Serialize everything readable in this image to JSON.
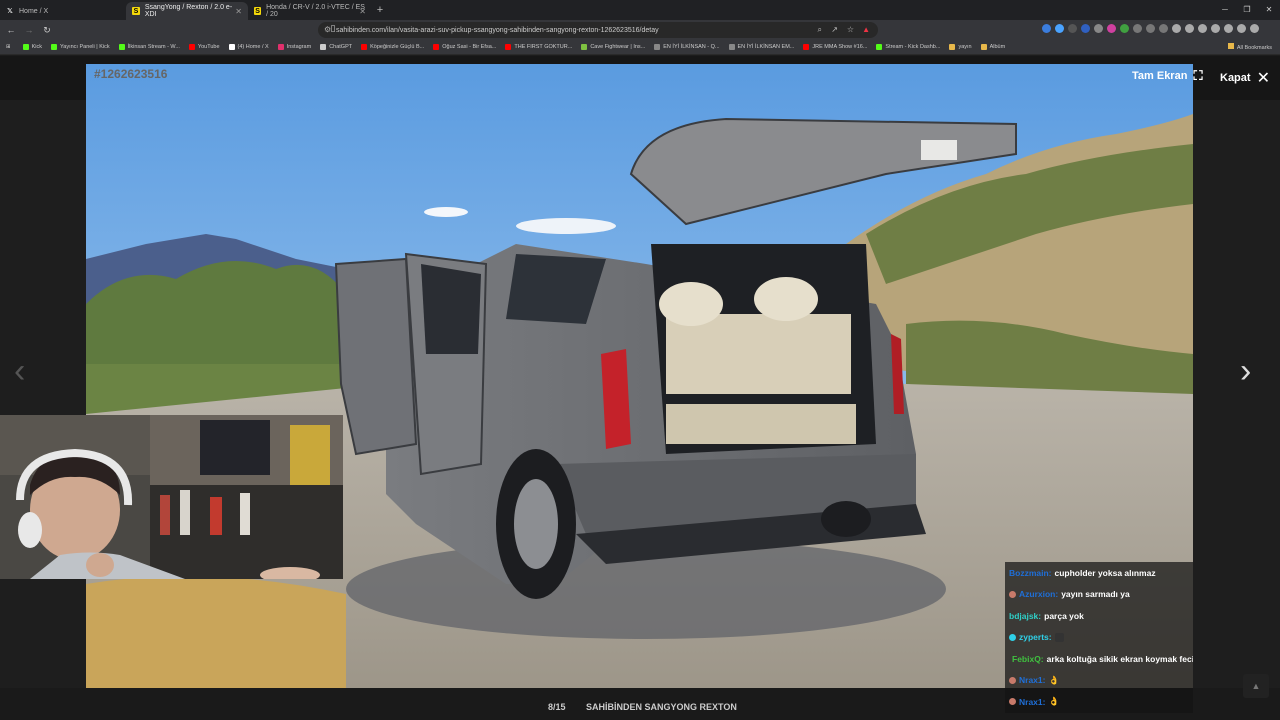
{
  "browser": {
    "tabs": [
      {
        "title": "Home / X",
        "icon": "x-logo-icon",
        "active": false
      },
      {
        "title": "SsangYong / Rexton / 2.0 e-XDI",
        "icon": "sahibinden-icon",
        "active": true
      },
      {
        "title": "Honda / CR-V / 2.0 i-VTEC / ES / 20",
        "icon": "sahibinden-icon",
        "active": false
      }
    ],
    "new_tab": "+",
    "url": "sahibinden.com/ilan/vasita-arazi-suv-pickup-ssangyong-sahibinden-sangyong-rexton-1262623516/detay",
    "bookmarks": [
      {
        "label": "Kick",
        "color": "#53fc18"
      },
      {
        "label": "Yayıncı Paneli | Kick",
        "color": "#53fc18"
      },
      {
        "label": "İlkinsan Stream - W...",
        "color": "#53fc18"
      },
      {
        "label": "YouTube",
        "color": "#ff0000"
      },
      {
        "label": "(4) Home / X",
        "color": "#ffffff"
      },
      {
        "label": "Instagram",
        "color": "#e1306c"
      },
      {
        "label": "ChatGPT",
        "color": "#cccccc"
      },
      {
        "label": "Köpeğinizle Güçlü B...",
        "color": "#ff0000"
      },
      {
        "label": "Oğuz Sasi - Bir Efsa...",
        "color": "#ff0000"
      },
      {
        "label": "THE FIRST GOKTUR...",
        "color": "#ff0000"
      },
      {
        "label": "Cave Fightwear | Ins...",
        "color": "#7fc241"
      },
      {
        "label": "EN İYİ İLKİNSAN - Q...",
        "color": "#888888"
      },
      {
        "label": "EN İYİ İLKİNSAN EM...",
        "color": "#888888"
      },
      {
        "label": "JRE MMA Show #16...",
        "color": "#ff0000"
      },
      {
        "label": "Stream - Kick Dashb...",
        "color": "#53fc18"
      },
      {
        "label": "yayın",
        "color": "#e8b84a"
      },
      {
        "label": "Albüm",
        "color": "#e8b84a"
      }
    ],
    "all_bookmarks": "All Bookmarks"
  },
  "viewer": {
    "listing_id": "#1262623516",
    "fullscreen_label": "Tam Ekran",
    "close_label": "Kapat",
    "counter": "8/15",
    "caption": "SAHİBİNDEN SANGYONG REXTON",
    "prev": "‹",
    "next": "›"
  },
  "chat": {
    "messages": [
      {
        "user": "Bozzmain:",
        "user_color": "#1f6fd8",
        "text": "cupholder yoksa alınmaz",
        "badge": false
      },
      {
        "user": "Azurxion:",
        "user_color": "#1f6fd8",
        "text": "yayın sarmadı ya",
        "badge": true
      },
      {
        "user": "bdjajsk:",
        "user_color": "#2fd0c8",
        "text": "parça yok",
        "badge": false
      },
      {
        "user": "zyperts:",
        "user_color": "#2fd0e8",
        "text": "",
        "badge": true
      },
      {
        "user": "FebixQ:",
        "user_color": "#40c040",
        "text": "arka koltuğa sikik ekran koymak feci bok",
        "badge": true
      },
      {
        "user": "Nrax1:",
        "user_color": "#1f6fd8",
        "text": "👌",
        "badge": true
      },
      {
        "user": "Nrax1:",
        "user_color": "#1f6fd8",
        "text": "👌",
        "badge": true
      }
    ]
  }
}
